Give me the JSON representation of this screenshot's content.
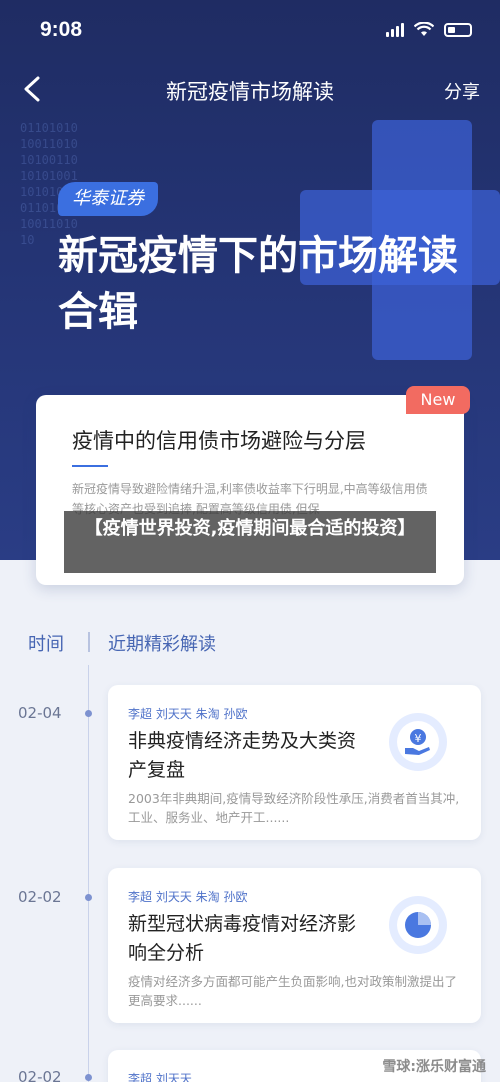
{
  "status": {
    "time": "9:08"
  },
  "nav": {
    "title": "新冠疫情市场解读",
    "share": "分享"
  },
  "banner": {
    "brand": "华泰证券",
    "title": "新冠疫情下的市场解读合辑",
    "binary_text": "0110101010011010101001101010100110101010011010101001101010"
  },
  "featured": {
    "badge": "New",
    "title": "疫情中的信用债市场避险与分层",
    "desc": "新冠疫情导致避险情绪升温,利率债收益率下行明显,中高等级信用债等核心资产也受到追捧,配置高等级信用债,但保"
  },
  "overlay": {
    "text": "【疫情世界投资,疫情期间最合适的投资】"
  },
  "section": {
    "time_label": "时间",
    "title": "近期精彩解读"
  },
  "articles": [
    {
      "date": "02-04",
      "authors": "李超 刘天天 朱淘 孙欧",
      "title": "非典疫情经济走势及大类资产复盘",
      "desc": "2003年非典期间,疫情导致经济阶段性承压,消费者首当其冲,工业、服务业、地产开工......",
      "icon": "yuan-hand-icon"
    },
    {
      "date": "02-02",
      "authors": "李超 刘天天 朱淘 孙欧",
      "title": "新型冠状病毒疫情对经济影响全分析",
      "desc": "疫情对经济多方面都可能产生负面影响,也对政策制激提出了更高要求......",
      "icon": "pie-chart-icon"
    },
    {
      "date": "02-02",
      "authors": "李超 刘天天",
      "title": "",
      "desc": "",
      "icon": ""
    }
  ],
  "watermark": "雪球:涨乐财富通"
}
